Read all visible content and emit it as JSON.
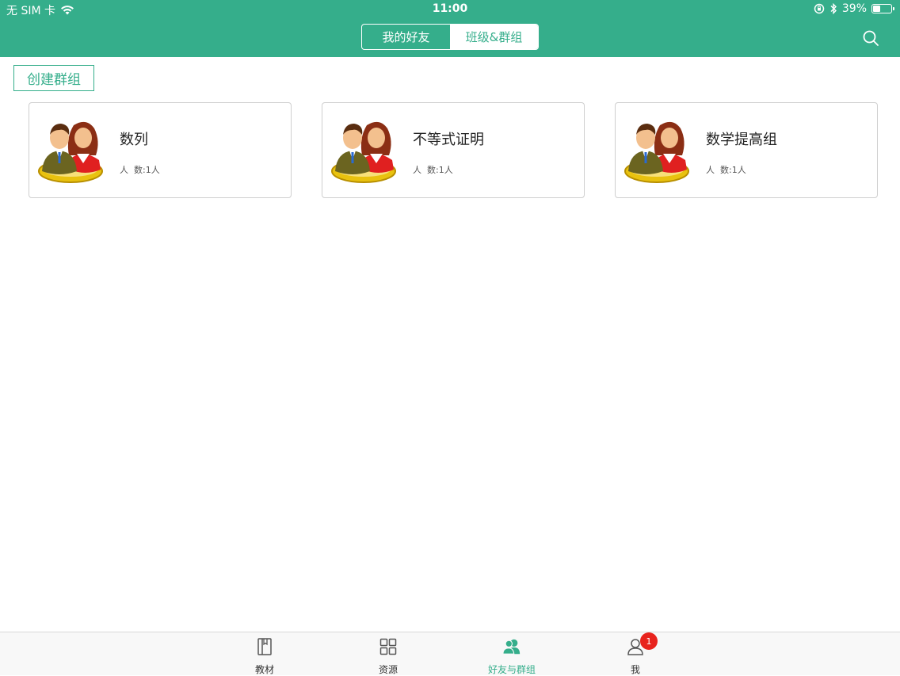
{
  "status_bar": {
    "carrier": "无 SIM 卡",
    "time": "11:00",
    "battery": "39%",
    "battery_level": 0.39
  },
  "header": {
    "tabs": [
      {
        "label": "我的好友",
        "active": false
      },
      {
        "label": "班级&群组",
        "active": true
      }
    ],
    "search_icon": "search-icon"
  },
  "create_group_label": "创建群组",
  "groups": [
    {
      "name": "数列",
      "count_label": "人  数:",
      "count": "1人"
    },
    {
      "name": "不等式证明",
      "count_label": "人  数:",
      "count": "1人"
    },
    {
      "name": "数学提高组",
      "count_label": "人  数:",
      "count": "1人"
    }
  ],
  "tabbar": {
    "items": [
      {
        "label": "教材",
        "icon": "book-icon",
        "active": false
      },
      {
        "label": "资源",
        "icon": "grid-icon",
        "active": false
      },
      {
        "label": "好友与群组",
        "icon": "people-icon",
        "active": true
      },
      {
        "label": "我",
        "icon": "person-icon",
        "active": false,
        "badge": "1"
      }
    ]
  },
  "colors": {
    "accent": "#35ae8b",
    "badge": "#e8231d"
  }
}
